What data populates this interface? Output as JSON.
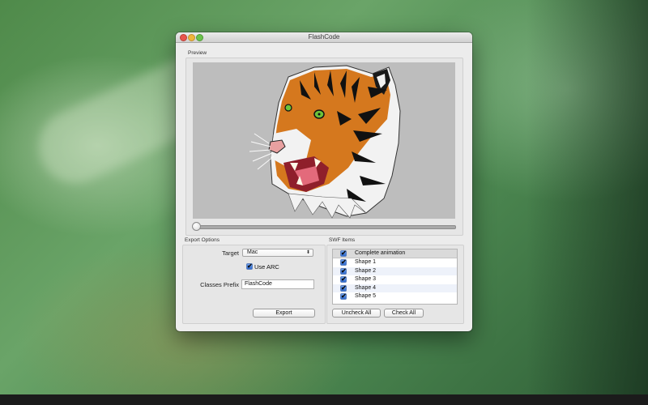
{
  "window": {
    "title": "FlashCode"
  },
  "preview": {
    "label": "Preview",
    "slider_value": 0
  },
  "export_options": {
    "label": "Export Options",
    "target_label": "Target",
    "target_value": "Mac",
    "use_arc_label": "Use ARC",
    "use_arc_checked": true,
    "classes_prefix_label": "Classes Prefix",
    "classes_prefix_value": "FlashCode",
    "export_button": "Export"
  },
  "swf_items": {
    "label": "SWF Items",
    "items": [
      {
        "label": "Complete animation",
        "checked": true
      },
      {
        "label": "Shape 1",
        "checked": true
      },
      {
        "label": "Shape 2",
        "checked": true
      },
      {
        "label": "Shape 3",
        "checked": true
      },
      {
        "label": "Shape 4",
        "checked": true
      },
      {
        "label": "Shape 5",
        "checked": true
      }
    ],
    "uncheck_all_button": "Uncheck All",
    "check_all_button": "Check All"
  },
  "icons": {
    "checkmark": "✔",
    "popup_arrows": "⬍"
  },
  "colors": {
    "accent_blue": "#2f6bd0",
    "tiger_orange": "#d5781e",
    "preview_bg": "#bdbdbd"
  }
}
